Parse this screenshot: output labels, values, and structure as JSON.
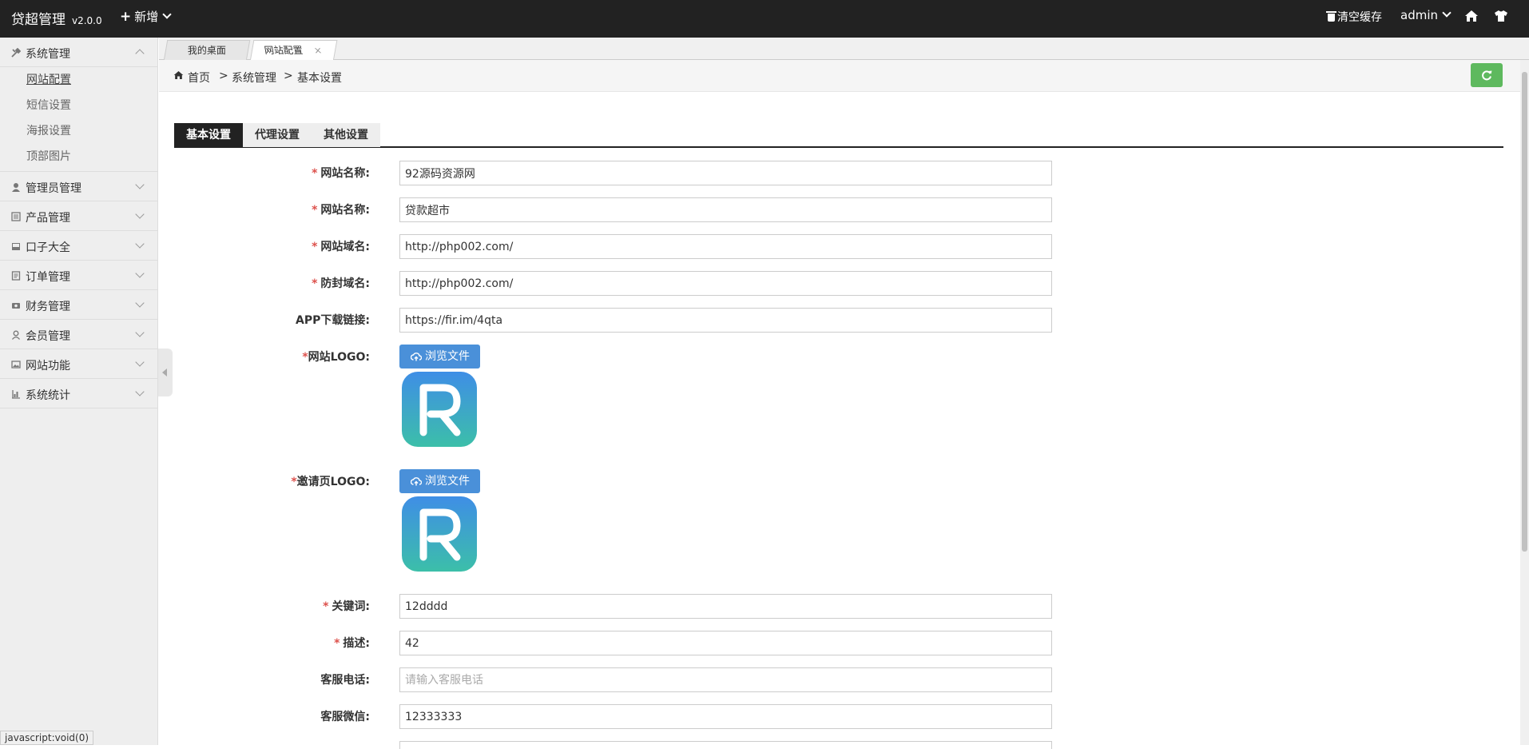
{
  "topbar": {
    "app_title": "贷超管理",
    "version": "v2.0.0",
    "add_new": "新增",
    "clear_cache": "清空缓存",
    "user": "admin"
  },
  "sidebar": {
    "groups": [
      {
        "label": "系统管理",
        "icon": "tools-icon",
        "expanded": true,
        "items": [
          "网站配置",
          "短信设置",
          "海报设置",
          "顶部图片"
        ]
      },
      {
        "label": "管理员管理",
        "icon": "user-icon"
      },
      {
        "label": "产品管理",
        "icon": "product-icon"
      },
      {
        "label": "口子大全",
        "icon": "inbox-icon"
      },
      {
        "label": "订单管理",
        "icon": "order-icon"
      },
      {
        "label": "财务管理",
        "icon": "money-icon"
      },
      {
        "label": "会员管理",
        "icon": "member-icon"
      },
      {
        "label": "网站功能",
        "icon": "image-icon"
      },
      {
        "label": "系统统计",
        "icon": "chart-icon"
      }
    ]
  },
  "window_tabs": [
    {
      "label": "我的桌面",
      "active": false
    },
    {
      "label": "网站配置",
      "active": true,
      "close": "×"
    }
  ],
  "breadcrumb": {
    "home": "首页",
    "sep": ">",
    "level1": "系统管理",
    "level2": "基本设置"
  },
  "form_tabs": [
    "基本设置",
    "代理设置",
    "其他设置"
  ],
  "form": {
    "site_name": {
      "label": "网站名称:",
      "value": "92源码资源网"
    },
    "site_name2": {
      "label": "网站名称:",
      "value": "贷款超市"
    },
    "domain": {
      "label": "网站域名:",
      "value": "http://php002.com/"
    },
    "antiblock_domain": {
      "label": "防封域名:",
      "value": "http://php002.com/"
    },
    "app_download": {
      "label": "APP下载链接:",
      "value": "https://fir.im/4qta"
    },
    "site_logo": {
      "label": "网站LOGO:",
      "button": "浏览文件"
    },
    "invite_logo": {
      "label": "邀请页LOGO:",
      "button": "浏览文件"
    },
    "keywords": {
      "label": "关键词:",
      "value": "12dddd"
    },
    "description": {
      "label": "描述:",
      "value": "42"
    },
    "service_phone": {
      "label": "客服电话:",
      "value": "",
      "placeholder": "请输入客服电话"
    },
    "service_wechat": {
      "label": "客服微信:",
      "value": "12333333"
    },
    "required_mark": "*"
  },
  "status_text": "javascript:void(0)",
  "colors": {
    "topbar": "#222222",
    "accent_blue": "#4a90d9",
    "refresh_green": "#5eb95e",
    "required_red": "#dd514c"
  }
}
